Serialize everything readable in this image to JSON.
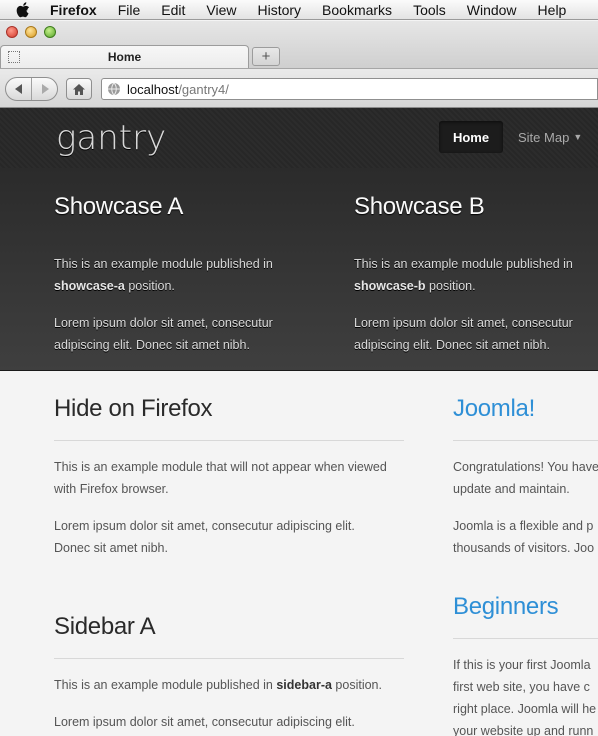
{
  "menubar": {
    "app": "Firefox",
    "items": [
      "File",
      "Edit",
      "View",
      "History",
      "Bookmarks",
      "Tools",
      "Window",
      "Help"
    ]
  },
  "browser": {
    "tab_title": "Home",
    "new_tab": "+",
    "url_host": "localhost",
    "url_path": "/gantry4/"
  },
  "site": {
    "logo": "gantry",
    "nav": {
      "home": "Home",
      "sitemap": "Site Map"
    }
  },
  "showcase": {
    "a": {
      "title": "Showcase A",
      "p1_pre": "This is an example module published in",
      "p1_bold": "showcase-a",
      "p1_post": " position.",
      "p2_l1": "Lorem ipsum dolor sit amet, consecutur",
      "p2_l2": "adipiscing elit. Donec sit amet nibh."
    },
    "b": {
      "title": "Showcase B",
      "p1_pre": "This is an example module published in",
      "p1_bold": "showcase-b",
      "p1_post": " position.",
      "p2_l1": "Lorem ipsum dolor sit amet, consecutur",
      "p2_l2": "adipiscing elit. Donec sit amet nibh."
    }
  },
  "main": {
    "hide": {
      "title": "Hide on Firefox",
      "l1": "This is an example module that will not appear when viewed",
      "l2": "with Firefox browser.",
      "l3": "Lorem ipsum dolor sit amet, consecutur adipiscing elit.",
      "l4": "Donec sit amet nibh."
    },
    "sidebar": {
      "title": "Sidebar A",
      "l1_pre": "This is an example module published in ",
      "l1_bold": "sidebar-a",
      "l1_post": " position.",
      "l2": "Lorem ipsum dolor sit amet, consecutur adipiscing elit."
    }
  },
  "side": {
    "joomla": {
      "title": "Joomla!",
      "l1": "Congratulations! You have",
      "l2": "update and maintain.",
      "l3": "Joomla is a flexible and p",
      "l4": "thousands of visitors. Joo"
    },
    "beginners": {
      "title": "Beginners",
      "l1": "If this is your first Joomla",
      "l2": "first web site, you have c",
      "l3": "right place. Joomla will he",
      "l4": "your website up and runn"
    }
  },
  "colors": {
    "accent": "#2e8fd6",
    "header": "#282828"
  }
}
